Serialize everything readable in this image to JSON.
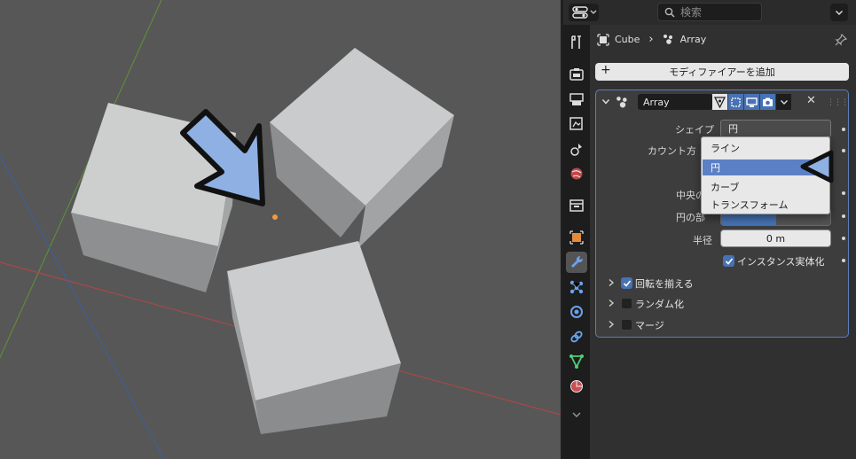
{
  "header": {
    "search_placeholder": "検索"
  },
  "breadcrumb": {
    "object": "Cube",
    "separator": "›",
    "modifier": "Array"
  },
  "add_modifier_label": "モディファイアーを追加",
  "modifier": {
    "name": "Array",
    "visibility": [
      "edit-mode",
      "on-cage",
      "viewport",
      "render"
    ]
  },
  "fields": {
    "shape_label": "シェイプ",
    "shape_value": "円",
    "count_label_partial": "カウント方",
    "center_label_partial": "中央の",
    "circle_label_partial": "円の部",
    "radius_label": "半径",
    "radius_value": "0 m",
    "realize_label": "インスタンス実体化",
    "realize_checked": true
  },
  "dropdown": {
    "options": [
      "ライン",
      "円",
      "カーブ",
      "トランスフォーム"
    ],
    "selected": "円"
  },
  "subpanels": [
    {
      "label": "回転を揃える",
      "checked": true
    },
    {
      "label": "ランダム化",
      "checked": false
    },
    {
      "label": "マージ",
      "checked": false
    }
  ],
  "tabs": [
    "tool",
    "render",
    "output",
    "view-layer",
    "scene",
    "world",
    "collection",
    "object",
    "modifiers",
    "particles",
    "physics",
    "constraints",
    "data",
    "material"
  ],
  "active_tab": "modifiers",
  "colors": {
    "accent": "#4772b3",
    "dropdown_selected": "#5b80c5",
    "panel_outline": "#5b7ebd",
    "arrow_fill": "#8fb0e2"
  }
}
